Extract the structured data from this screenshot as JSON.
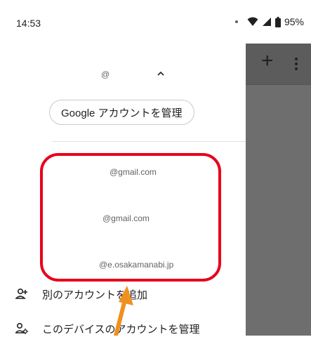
{
  "status_bar": {
    "time": "14:53",
    "battery": "95%",
    "icons": [
      "wifi-icon",
      "signal-icon",
      "battery-icon"
    ]
  },
  "drawer": {
    "current_account": "@",
    "manage_button": "Google アカウントを管理",
    "accounts": [
      "@gmail.com",
      "@gmail.com",
      "@e.osakamanabi.jp"
    ],
    "actions": [
      {
        "label": "別のアカウントを追加",
        "icon": "add-person-icon"
      },
      {
        "label": "このデバイスのアカウントを管理",
        "icon": "manage-accounts-icon"
      }
    ]
  },
  "background_app": {
    "icons": [
      "plus-icon",
      "more-vert-icon"
    ]
  },
  "annotation": {
    "box_color": "#e8001a",
    "arrow_color": "#f0901e"
  }
}
